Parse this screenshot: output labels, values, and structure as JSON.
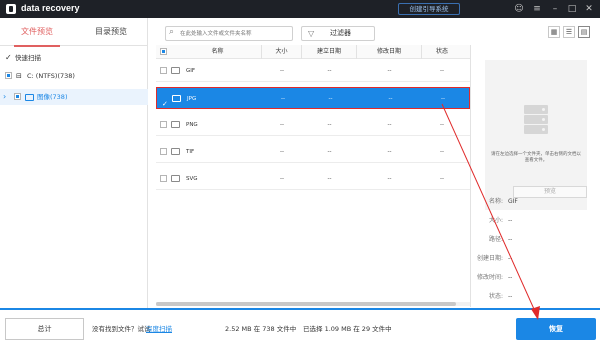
{
  "titlebar": {
    "app_title": "data recovery",
    "tool_button": "创建引导系统",
    "icons": [
      "person-icon",
      "menu-icon",
      "minimize-icon",
      "maximize-icon",
      "close-icon"
    ]
  },
  "left": {
    "tabs": [
      "文件预览",
      "目录预览"
    ],
    "quick_scan": "快速扫描",
    "drive": "C: (NTFS)(738)",
    "images": "图像(738)"
  },
  "toolbar": {
    "search_placeholder": "在此处输入文件或文件夹名称",
    "filter_label": "过滤器"
  },
  "table": {
    "headers": [
      "名称",
      "大小",
      "建立日期",
      "修改日期",
      "状态"
    ],
    "rows": [
      {
        "name": "GIF",
        "size": "--",
        "created": "--",
        "modified": "--",
        "status": "--",
        "checked": false
      },
      {
        "name": "JPG",
        "size": "--",
        "created": "--",
        "modified": "--",
        "status": "--",
        "checked": true
      },
      {
        "name": "PNG",
        "size": "--",
        "created": "--",
        "modified": "--",
        "status": "--",
        "checked": false
      },
      {
        "name": "TIF",
        "size": "--",
        "created": "--",
        "modified": "--",
        "status": "--",
        "checked": false
      },
      {
        "name": "SVG",
        "size": "--",
        "created": "--",
        "modified": "--",
        "status": "--",
        "checked": false
      }
    ]
  },
  "preview": {
    "hint": "请在左边选择一个文件夹，单击右侧的文档以查看文件。",
    "button": "预览",
    "info": [
      {
        "k": "名称:",
        "v": "GIF"
      },
      {
        "k": "大小:",
        "v": "--"
      },
      {
        "k": "路径:",
        "v": "--"
      },
      {
        "k": "创建日期:",
        "v": "--"
      },
      {
        "k": "修改时间:",
        "v": "--"
      },
      {
        "k": "状态:",
        "v": "--"
      }
    ]
  },
  "bottom": {
    "summary": "总计",
    "not_found": "没有找到文件？试试",
    "deep_scan": "深度扫描",
    "found": "2.52 MB 在 738 文件中",
    "selected": "已选择 1.09 MB 在 29 文件中",
    "recover": "恢复"
  },
  "colors": {
    "accent": "#1b87e5",
    "tab_active": "#e06060",
    "titlebar": "#1e2127",
    "annotation": "#e02a2a"
  }
}
